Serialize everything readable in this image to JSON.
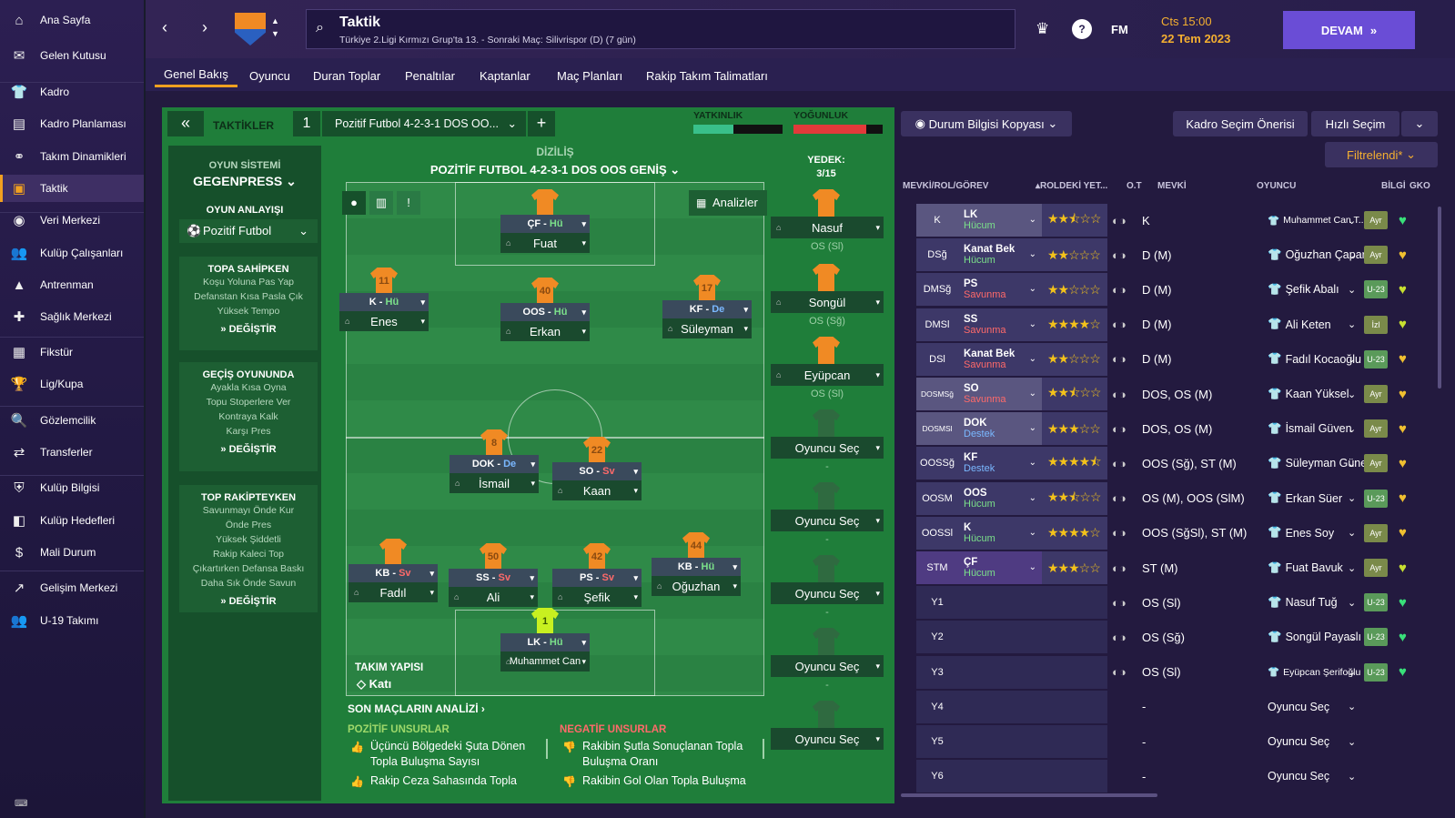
{
  "sidebar": {
    "items": [
      {
        "label": "Ana Sayfa",
        "icon": "home-icon",
        "glyph": "⌂"
      },
      {
        "label": "Gelen Kutusu",
        "icon": "inbox-icon",
        "glyph": "✉"
      },
      {
        "label": "Kadro",
        "icon": "squad-icon",
        "glyph": "👕"
      },
      {
        "label": "Kadro Planlaması",
        "icon": "squad-planner-icon",
        "glyph": "▤"
      },
      {
        "label": "Takım Dinamikleri",
        "icon": "dynamics-icon",
        "glyph": "⚭"
      },
      {
        "label": "Taktik",
        "icon": "tactics-icon",
        "glyph": "▣"
      },
      {
        "label": "Veri Merkezi",
        "icon": "data-hub-icon",
        "glyph": "◉"
      },
      {
        "label": "Kulüp Çalışanları",
        "icon": "staff-icon",
        "glyph": "👥"
      },
      {
        "label": "Antrenman",
        "icon": "training-icon",
        "glyph": "▲"
      },
      {
        "label": "Sağlık Merkezi",
        "icon": "medical-icon",
        "glyph": "✚"
      },
      {
        "label": "Fikstür",
        "icon": "fixtures-icon",
        "glyph": "▦"
      },
      {
        "label": "Lig/Kupa",
        "icon": "trophy-icon",
        "glyph": "🏆"
      },
      {
        "label": "Gözlemcilik",
        "icon": "scouting-icon",
        "glyph": "🔍"
      },
      {
        "label": "Transferler",
        "icon": "transfers-icon",
        "glyph": "⇄"
      },
      {
        "label": "Kulüp Bilgisi",
        "icon": "club-info-icon",
        "glyph": "⛨"
      },
      {
        "label": "Kulüp Hedefleri",
        "icon": "club-vision-icon",
        "glyph": "◧"
      },
      {
        "label": "Mali Durum",
        "icon": "finances-icon",
        "glyph": "$"
      },
      {
        "label": "Gelişim Merkezi",
        "icon": "development-icon",
        "glyph": "↗"
      },
      {
        "label": "U-19 Takımı",
        "icon": "u19-icon",
        "glyph": "👥"
      }
    ]
  },
  "header": {
    "title": "Taktik",
    "subtitle": "Türkiye 2.Ligi Kırmızı Grup'ta 13. - Sonraki Maç: Silivrispor (D) (7 gün)",
    "fm": "FM",
    "day": "Cts 15:00",
    "date": "22 Tem 2023",
    "continue": "DEVAM"
  },
  "tabs": [
    "Genel Bakış",
    "Oyuncu",
    "Duran Toplar",
    "Penaltılar",
    "Kaptanlar",
    "Maç Planları",
    "Rakip Takım Talimatları"
  ],
  "tactic": {
    "section": "TAKTİKLER",
    "slot": "1",
    "name": "Pozitif Futbol 4-2-3-1 DOS OO...",
    "familiarity": "YATKINLIK",
    "intensity": "YOĞUNLUK",
    "formation_label": "DİZİLİŞ",
    "formation": "POZİTİF FUTBOL 4-2-3-1 DOS OOS GENİŞ",
    "analyse": "Analizler",
    "bench_label": "YEDEK:",
    "bench_count": "3/15",
    "team_shape_label": "TAKIM YAPISI",
    "team_shape": "Katı"
  },
  "system": {
    "label": "OYUN SİSTEMİ",
    "value": "GEGENPRESS",
    "mentality_label": "OYUN ANLAYIŞI",
    "mentality": "Pozitif Futbol"
  },
  "cards": [
    {
      "title": "TOPA SAHİPKEN",
      "lines": [
        "Koşu Yoluna Pas Yap",
        "Defanstan Kısa Pasla Çık",
        "Yüksek Tempo"
      ],
      "change": "DEĞİŞTİR"
    },
    {
      "title": "GEÇİŞ OYUNUNDA",
      "lines": [
        "Ayakla Kısa Oyna",
        "Topu Stoperlere Ver",
        "Kontraya Kalk",
        "Karşı Pres"
      ],
      "change": "DEĞİŞTİR"
    },
    {
      "title": "TOP RAKİPTEYKEN",
      "lines": [
        "Savunmayı Önde Kur",
        "Önde Pres",
        "Yüksek Şiddetli",
        "Rakip Kaleci Top",
        "Çıkartırken Defansa Baskı",
        "Daha Sık Önde Savun"
      ],
      "change": "DEĞİŞTİR"
    }
  ],
  "pitch": [
    {
      "num": "",
      "role": "ÇF",
      "duty": "Hü",
      "name": "Fuat"
    },
    {
      "num": "11",
      "role": "K",
      "duty": "Hü",
      "name": "Enes"
    },
    {
      "num": "40",
      "role": "OOS",
      "duty": "Hü",
      "name": "Erkan"
    },
    {
      "num": "17",
      "role": "KF",
      "duty": "De",
      "name": "Süleyman"
    },
    {
      "num": "8",
      "role": "DOK",
      "duty": "De",
      "name": "İsmail"
    },
    {
      "num": "22",
      "role": "SO",
      "duty": "Sv",
      "name": "Kaan"
    },
    {
      "num": "",
      "role": "KB",
      "duty": "Sv",
      "name": "Fadıl"
    },
    {
      "num": "50",
      "role": "SS",
      "duty": "Sv",
      "name": "Ali"
    },
    {
      "num": "42",
      "role": "PS",
      "duty": "Sv",
      "name": "Şefik"
    },
    {
      "num": "44",
      "role": "KB",
      "duty": "Hü",
      "name": "Oğuzhan"
    },
    {
      "num": "1",
      "role": "LK",
      "duty": "Hü",
      "name": "Muhammet Can"
    }
  ],
  "subs": [
    {
      "name": "Nasuf",
      "pos": "OS (Sl)"
    },
    {
      "name": "Songül",
      "pos": "OS (Sğ)"
    },
    {
      "name": "Eyüpcan",
      "pos": "OS (Sl)"
    },
    {
      "name": "Oyuncu Seç",
      "pos": "-"
    },
    {
      "name": "Oyuncu Seç",
      "pos": "-"
    },
    {
      "name": "Oyuncu Seç",
      "pos": "-"
    },
    {
      "name": "Oyuncu Seç",
      "pos": "-"
    },
    {
      "name": "Oyuncu Seç",
      "pos": ""
    }
  ],
  "analysis": {
    "title": "SON MAÇLARIN ANALİZİ",
    "pos_label": "POZİTİF UNSURLAR",
    "neg_label": "NEGATİF UNSURLAR",
    "pos": [
      "Üçüncü Bölgedeki Şuta Dönen Topla Buluşma Sayısı",
      "Rakip Ceza Sahasında Topla"
    ],
    "neg": [
      "Rakibin Şutla Sonuçlanan Topla Buluşma Oranı",
      "Rakibin Gol Olan Topla Buluşma"
    ]
  },
  "right": {
    "copy_info": "Durum Bilgisi Kopyası",
    "squad_suggest": "Kadro Seçim Önerisi",
    "quick_pick": "Hızlı Seçim",
    "filter": "Filtrelendi*"
  },
  "columns": [
    "MEVKİ/ROL/GÖREV",
    "ROLDEKİ YET...",
    "O.T",
    "MEVKİ",
    "OYUNCU",
    "BİLGİ",
    "GKO"
  ],
  "rows": [
    {
      "pos": "K",
      "role": "LK",
      "duty": "Hücum",
      "stars": 2.5,
      "mevki": "K",
      "player": "Muhammet Can T...",
      "info": "Ayr",
      "gko": "#39e07a"
    },
    {
      "pos": "DSğ",
      "role": "Kanat Bek",
      "duty": "Hücum",
      "stars": 2,
      "mevki": "D (M)",
      "player": "Oğuzhan Çapar",
      "info": "Ayr",
      "gko": "#f0c030"
    },
    {
      "pos": "DMSğ",
      "role": "PS",
      "duty": "Savunma",
      "stars": 2,
      "mevki": "D (M)",
      "player": "Şefik Abalı",
      "info": "U-23",
      "gko": "#c8e030"
    },
    {
      "pos": "DMSl",
      "role": "SS",
      "duty": "Savunma",
      "stars": 4,
      "mevki": "D (M)",
      "player": "Ali Keten",
      "info": "İzl",
      "gko": "#c8e030"
    },
    {
      "pos": "DSl",
      "role": "Kanat Bek",
      "duty": "Savunma",
      "stars": 2,
      "mevki": "D (M)",
      "player": "Fadıl Kocaoğlu",
      "info": "U-23",
      "gko": "#f0c030"
    },
    {
      "pos": "DOSMSğ",
      "role": "SO",
      "duty": "Savunma",
      "stars": 2.5,
      "mevki": "DOS, OS (M)",
      "player": "Kaan Yüksel",
      "info": "Ayr",
      "gko": "#f0c030"
    },
    {
      "pos": "DOSMSl",
      "role": "DOK",
      "duty": "Destek",
      "stars": 3,
      "mevki": "DOS, OS (M)",
      "player": "İsmail Güven",
      "info": "Ayr",
      "gko": "#f0c030"
    },
    {
      "pos": "OOSSğ",
      "role": "KF",
      "duty": "Destek",
      "stars": 4.5,
      "mevki": "OOS (Sğ), ST (M)",
      "player": "Süleyman Güneş",
      "info": "Ayr",
      "gko": "#f0c030"
    },
    {
      "pos": "OOSM",
      "role": "OOS",
      "duty": "Hücum",
      "stars": 2.5,
      "mevki": "OS (M), OOS (SlM)",
      "player": "Erkan Süer",
      "info": "U-23",
      "gko": "#f0c030"
    },
    {
      "pos": "OOSSl",
      "role": "K",
      "duty": "Hücum",
      "stars": 4,
      "mevki": "OOS (SğSl), ST (M)",
      "player": "Enes Soy",
      "info": "Ayr",
      "gko": "#f0c030"
    },
    {
      "pos": "STM",
      "role": "ÇF",
      "duty": "Hücum",
      "stars": 3,
      "mevki": "ST (M)",
      "player": "Fuat Bavuk",
      "info": "Ayr",
      "gko": "#c8e030"
    },
    {
      "pos": "Y1",
      "role": "",
      "duty": "",
      "stars": 0,
      "mevki": "OS (Sl)",
      "player": "Nasuf Tuğ",
      "info": "U-23",
      "gko": "#39e07a"
    },
    {
      "pos": "Y2",
      "role": "",
      "duty": "",
      "stars": 0,
      "mevki": "OS (Sğ)",
      "player": "Songül Payaslı",
      "info": "U-23",
      "gko": "#39e07a"
    },
    {
      "pos": "Y3",
      "role": "",
      "duty": "",
      "stars": 0,
      "mevki": "OS (Sl)",
      "player": "Eyüpcan Şerifoğlu",
      "info": "U-23",
      "gko": "#39e07a"
    },
    {
      "pos": "Y4",
      "role": "",
      "duty": "",
      "stars": 0,
      "mevki": "-",
      "player": "Oyuncu Seç",
      "info": "",
      "gko": ""
    },
    {
      "pos": "Y5",
      "role": "",
      "duty": "",
      "stars": 0,
      "mevki": "-",
      "player": "Oyuncu Seç",
      "info": "",
      "gko": ""
    },
    {
      "pos": "Y6",
      "role": "",
      "duty": "",
      "stars": 0,
      "mevki": "-",
      "player": "Oyuncu Seç",
      "info": "",
      "gko": ""
    }
  ]
}
